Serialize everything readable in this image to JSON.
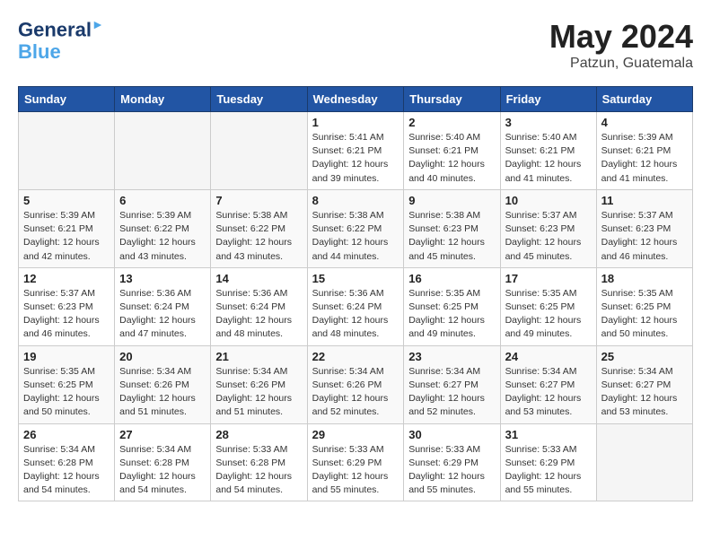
{
  "header": {
    "logo_line1": "General",
    "logo_line2": "Blue",
    "month_year": "May 2024",
    "location": "Patzun, Guatemala"
  },
  "days_of_week": [
    "Sunday",
    "Monday",
    "Tuesday",
    "Wednesday",
    "Thursday",
    "Friday",
    "Saturday"
  ],
  "weeks": [
    [
      {
        "day": "",
        "info": ""
      },
      {
        "day": "",
        "info": ""
      },
      {
        "day": "",
        "info": ""
      },
      {
        "day": "1",
        "info": "Sunrise: 5:41 AM\nSunset: 6:21 PM\nDaylight: 12 hours\nand 39 minutes."
      },
      {
        "day": "2",
        "info": "Sunrise: 5:40 AM\nSunset: 6:21 PM\nDaylight: 12 hours\nand 40 minutes."
      },
      {
        "day": "3",
        "info": "Sunrise: 5:40 AM\nSunset: 6:21 PM\nDaylight: 12 hours\nand 41 minutes."
      },
      {
        "day": "4",
        "info": "Sunrise: 5:39 AM\nSunset: 6:21 PM\nDaylight: 12 hours\nand 41 minutes."
      }
    ],
    [
      {
        "day": "5",
        "info": "Sunrise: 5:39 AM\nSunset: 6:21 PM\nDaylight: 12 hours\nand 42 minutes."
      },
      {
        "day": "6",
        "info": "Sunrise: 5:39 AM\nSunset: 6:22 PM\nDaylight: 12 hours\nand 43 minutes."
      },
      {
        "day": "7",
        "info": "Sunrise: 5:38 AM\nSunset: 6:22 PM\nDaylight: 12 hours\nand 43 minutes."
      },
      {
        "day": "8",
        "info": "Sunrise: 5:38 AM\nSunset: 6:22 PM\nDaylight: 12 hours\nand 44 minutes."
      },
      {
        "day": "9",
        "info": "Sunrise: 5:38 AM\nSunset: 6:23 PM\nDaylight: 12 hours\nand 45 minutes."
      },
      {
        "day": "10",
        "info": "Sunrise: 5:37 AM\nSunset: 6:23 PM\nDaylight: 12 hours\nand 45 minutes."
      },
      {
        "day": "11",
        "info": "Sunrise: 5:37 AM\nSunset: 6:23 PM\nDaylight: 12 hours\nand 46 minutes."
      }
    ],
    [
      {
        "day": "12",
        "info": "Sunrise: 5:37 AM\nSunset: 6:23 PM\nDaylight: 12 hours\nand 46 minutes."
      },
      {
        "day": "13",
        "info": "Sunrise: 5:36 AM\nSunset: 6:24 PM\nDaylight: 12 hours\nand 47 minutes."
      },
      {
        "day": "14",
        "info": "Sunrise: 5:36 AM\nSunset: 6:24 PM\nDaylight: 12 hours\nand 48 minutes."
      },
      {
        "day": "15",
        "info": "Sunrise: 5:36 AM\nSunset: 6:24 PM\nDaylight: 12 hours\nand 48 minutes."
      },
      {
        "day": "16",
        "info": "Sunrise: 5:35 AM\nSunset: 6:25 PM\nDaylight: 12 hours\nand 49 minutes."
      },
      {
        "day": "17",
        "info": "Sunrise: 5:35 AM\nSunset: 6:25 PM\nDaylight: 12 hours\nand 49 minutes."
      },
      {
        "day": "18",
        "info": "Sunrise: 5:35 AM\nSunset: 6:25 PM\nDaylight: 12 hours\nand 50 minutes."
      }
    ],
    [
      {
        "day": "19",
        "info": "Sunrise: 5:35 AM\nSunset: 6:25 PM\nDaylight: 12 hours\nand 50 minutes."
      },
      {
        "day": "20",
        "info": "Sunrise: 5:34 AM\nSunset: 6:26 PM\nDaylight: 12 hours\nand 51 minutes."
      },
      {
        "day": "21",
        "info": "Sunrise: 5:34 AM\nSunset: 6:26 PM\nDaylight: 12 hours\nand 51 minutes."
      },
      {
        "day": "22",
        "info": "Sunrise: 5:34 AM\nSunset: 6:26 PM\nDaylight: 12 hours\nand 52 minutes."
      },
      {
        "day": "23",
        "info": "Sunrise: 5:34 AM\nSunset: 6:27 PM\nDaylight: 12 hours\nand 52 minutes."
      },
      {
        "day": "24",
        "info": "Sunrise: 5:34 AM\nSunset: 6:27 PM\nDaylight: 12 hours\nand 53 minutes."
      },
      {
        "day": "25",
        "info": "Sunrise: 5:34 AM\nSunset: 6:27 PM\nDaylight: 12 hours\nand 53 minutes."
      }
    ],
    [
      {
        "day": "26",
        "info": "Sunrise: 5:34 AM\nSunset: 6:28 PM\nDaylight: 12 hours\nand 54 minutes."
      },
      {
        "day": "27",
        "info": "Sunrise: 5:34 AM\nSunset: 6:28 PM\nDaylight: 12 hours\nand 54 minutes."
      },
      {
        "day": "28",
        "info": "Sunrise: 5:33 AM\nSunset: 6:28 PM\nDaylight: 12 hours\nand 54 minutes."
      },
      {
        "day": "29",
        "info": "Sunrise: 5:33 AM\nSunset: 6:29 PM\nDaylight: 12 hours\nand 55 minutes."
      },
      {
        "day": "30",
        "info": "Sunrise: 5:33 AM\nSunset: 6:29 PM\nDaylight: 12 hours\nand 55 minutes."
      },
      {
        "day": "31",
        "info": "Sunrise: 5:33 AM\nSunset: 6:29 PM\nDaylight: 12 hours\nand 55 minutes."
      },
      {
        "day": "",
        "info": ""
      }
    ]
  ]
}
